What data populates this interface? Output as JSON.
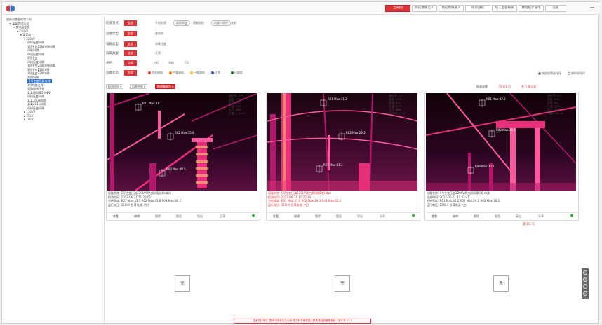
{
  "header": {
    "nav": [
      {
        "label": "全局图",
        "active": true
      },
      {
        "label": "热成像报告人",
        "active": false
      },
      {
        "label": "热成像报警人",
        "active": false
      },
      {
        "label": "隐患跟踪",
        "active": false
      },
      {
        "label": "热工监督报表",
        "active": false
      },
      {
        "label": "数据统计管理",
        "active": false
      },
      {
        "label": "设置",
        "active": false
      }
    ]
  },
  "sidebar": {
    "items": [
      {
        "label": "国网河南省电力公司",
        "indent": 0
      },
      {
        "label": "▾ 某某供电公司",
        "indent": 1
      },
      {
        "label": "▾ 变电运检室",
        "indent": 2
      },
      {
        "label": "▾ 220kV",
        "indent": 3
      },
      {
        "label": "▾ 某某站",
        "indent": 4
      },
      {
        "label": "▾ 220kV",
        "indent": 5
      },
      {
        "label": "母线压变间隔",
        "indent": 6
      },
      {
        "label": "1号主变220kV侧间隔",
        "indent": 6
      },
      {
        "label": "母联间隔",
        "indent": 6
      },
      {
        "label": "母线压变间隔",
        "indent": 6
      },
      {
        "label": "2号主变",
        "indent": 6
      },
      {
        "label": "母线压变间隔",
        "indent": 6
      },
      {
        "label": "1号主变220kV侧间隔",
        "indent": 6
      },
      {
        "label": "2号主变220kV侧",
        "indent": 6
      },
      {
        "label": "3号主变220kV侧",
        "indent": 6
      },
      {
        "label": "旁路间隔",
        "indent": 6
      },
      {
        "label": "1号主变压器出线",
        "indent": 6,
        "selected": true
      },
      {
        "label": "1号线路出线",
        "indent": 6
      },
      {
        "label": "旁路母线压变",
        "indent": 6
      },
      {
        "label": "某某线间隔220kV",
        "indent": 6
      },
      {
        "label": "母线压变间隔",
        "indent": 6
      },
      {
        "label": "某某2003间隔",
        "indent": 6
      },
      {
        "label": "某某2011间隔",
        "indent": 6
      },
      {
        "label": "母线压变间隔",
        "indent": 6
      },
      {
        "label": "▸ 110kV",
        "indent": 5
      },
      {
        "label": "▸ 35kV",
        "indent": 5
      },
      {
        "label": "▸ 10kV",
        "indent": 5
      }
    ]
  },
  "filters": {
    "all_label": "全部",
    "rows": [
      {
        "label": "检测方式:",
        "options": [
          "手动检测",
          "遥视测温",
          "鹰眼巡检",
          "机器人巡检",
          "其他"
        ]
      },
      {
        "label": "设备类型:",
        "options": [
          "变电站"
        ]
      },
      {
        "label": "设备类型:",
        "options": [
          "母线压变"
        ]
      },
      {
        "label": "异常类型:",
        "options": [
          "正常"
        ]
      },
      {
        "label": "相别:",
        "options": [
          "A相",
          "B相",
          "C相"
        ]
      },
      {
        "label": "设备状态:",
        "options": [
          "危急缺陷",
          "严重缺陷",
          "一般缺陷",
          "正常",
          "已跟踪"
        ]
      }
    ],
    "status_colors": [
      "#e53935",
      "#f57c00",
      "#fbc02d",
      "#3949ab",
      "#2e7d32"
    ],
    "view_modes": [
      "按缺陷等级排序",
      "按时间排序"
    ]
  },
  "toolbar": {
    "buttons": [
      "检测时间 ▾",
      "设备名称 ▾",
      "热成像报告 ▾"
    ],
    "right": [
      "批量选择",
      "第 1/1 页",
      "共 3 条记录"
    ]
  },
  "cards": [
    {
      "labels": [
        "R01 Max:31.1",
        "R02 Max:35.8",
        "R03 Max:30.5"
      ],
      "side": [
        "辐射率: 0.9",
        "湿度: 65%",
        "距离: 5m",
        "环温: 28℃",
        "天气: 晴朗",
        "风速: 0.5m/s"
      ],
      "info": [
        "设备名称: 1号主变压器220kV侧刀闸间隔A相-本体",
        "检测时间: 2017-06-21 11:23:02",
        "分析温度: R01 Max:31.1 R02 Max:35.8 R03 Max:30.5",
        "运行电压: 220kV   负荷电流: (空)"
      ],
      "actions": [
        "查看",
        "编辑",
        "删除",
        "报告",
        "导出",
        "分享"
      ],
      "red": false
    },
    {
      "labels": [
        "R01 Max:31.2",
        "R02 Max:29.3",
        "R03 Max:31.2"
      ],
      "side": [
        "辐射率: 0.9",
        "湿度: 63%",
        "距离: 4m",
        "环温: 29℃",
        "天气: 晴朗",
        "风速: 0.8m/s"
      ],
      "info": [
        "设备名称: 1号主变压器220kV侧刀闸间隔B相-本体",
        "检测时间: 2017-06-21 11:23:24",
        "分析温度: R01 Max:31.2 R02 Max:29.3 R03 Max:31.2",
        "运行电压: 220kV   负荷电流: (空)"
      ],
      "actions": [
        "查看",
        "编辑",
        "删除",
        "报告",
        "导出",
        "分享"
      ],
      "red": true
    },
    {
      "labels": [
        "R01 Max:32.2",
        "R02 Max:29.2",
        "R03 Max:30.1"
      ],
      "side": [
        "辐射率: 0.9",
        "湿度: 66%",
        "距离: 5m",
        "环温: 28℃",
        "天气: 晴朗",
        "风速: 0.6m/s"
      ],
      "info": [
        "设备名称: 1号主变压器220kV侧刀闸间隔C相-本体",
        "检测时间: 2017-06-21 11:23:41",
        "分析温度: R01 Max:32.2 R02 Max:29.2 R03 Max:30.1",
        "运行电压: 220kV   负荷电流: (空)"
      ],
      "actions": [
        "查看",
        "编辑",
        "删除",
        "报告",
        "导出",
        "分享"
      ],
      "red": false
    }
  ],
  "pager": "第 1/1 页",
  "placeholders": [
    "无",
    "无",
    "无"
  ],
  "footer": "技术支持单位: 国网河南省电力公司 电力科学研究院 | 热成像检测管理系统 | 版本号 V1.0"
}
